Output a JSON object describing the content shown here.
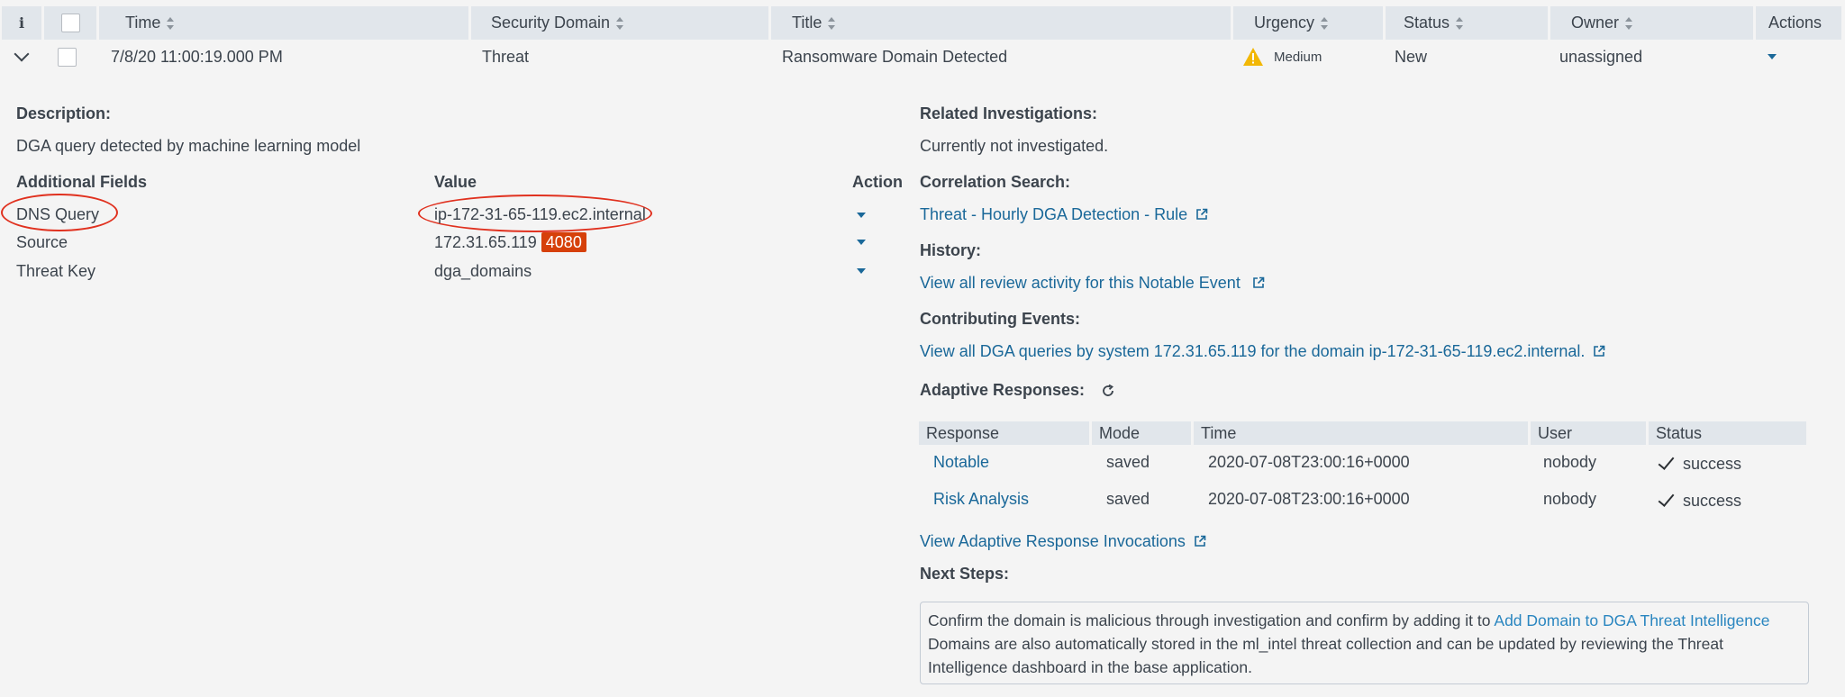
{
  "header": {
    "info": "i",
    "time": "Time",
    "security_domain": "Security Domain",
    "title": "Title",
    "urgency": "Urgency",
    "status": "Status",
    "owner": "Owner",
    "actions": "Actions"
  },
  "event": {
    "time": "7/8/20 11:00:19.000 PM",
    "security_domain": "Threat",
    "title": "Ransomware Domain Detected",
    "urgency": "Medium",
    "status": "New",
    "owner": "unassigned"
  },
  "details": {
    "description_label": "Description:",
    "description": "DGA query detected by machine learning model",
    "fields_header": "Additional Fields",
    "value_header": "Value",
    "action_header": "Action",
    "fields": [
      {
        "name": "DNS Query",
        "value": "ip-172-31-65-119.ec2.internal"
      },
      {
        "name": "Source",
        "value": "172.31.65.119",
        "badge": "4080"
      },
      {
        "name": "Threat Key",
        "value": "dga_domains"
      }
    ]
  },
  "right": {
    "related_label": "Related Investigations:",
    "related_value": "Currently not investigated.",
    "correlation_label": "Correlation Search:",
    "correlation_link": "Threat - Hourly DGA Detection - Rule",
    "history_label": "History:",
    "history_link": "View all review activity for this Notable Event",
    "contributing_label": "Contributing Events:",
    "contributing_link": "View all DGA queries by system 172.31.65.119 for the domain ip-172-31-65-119.ec2.internal.",
    "adaptive_label": "Adaptive Responses:",
    "ar_columns": [
      "Response",
      "Mode",
      "Time",
      "User",
      "Status"
    ],
    "ar_rows": [
      {
        "response": "Notable",
        "mode": "saved",
        "time": "2020-07-08T23:00:16+0000",
        "user": "nobody",
        "status": "success"
      },
      {
        "response": "Risk Analysis",
        "mode": "saved",
        "time": "2020-07-08T23:00:16+0000",
        "user": "nobody",
        "status": "success"
      }
    ],
    "invocations_link": "View Adaptive Response Invocations",
    "next_steps_label": "Next Steps:",
    "next_steps_text1": "Confirm the domain is malicious through investigation and confirm by adding it to ",
    "next_steps_link": "Add Domain to DGA Threat Intelligence",
    "next_steps_text2": "Domains are also automatically stored in the ml_intel threat collection and can be updated by reviewing the Threat Intelligence dashboard in the base application."
  },
  "colors": {
    "link": "#1a6899",
    "header_bg": "#e1e6eb",
    "badge": "#d6400a",
    "annotation": "#e0311f",
    "warning": "#f2b705"
  }
}
